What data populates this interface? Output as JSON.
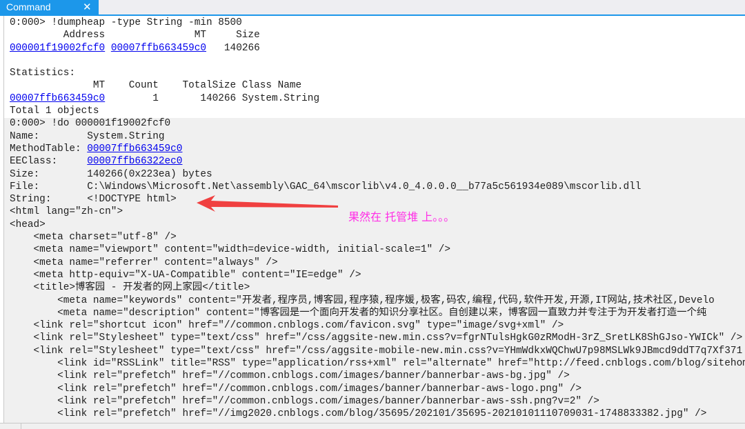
{
  "tab": {
    "title": "Command",
    "close_icon": "close-icon"
  },
  "colors": {
    "tab_bg": "#1c97ea",
    "link": "#0000ee",
    "annotation": "#ff2ee6",
    "arrow": "#f04040",
    "output_bg_gray": "#f0f0f0"
  },
  "output_lines": [
    [
      {
        "t": "0:000> !dumpheap -type String -min 8500"
      }
    ],
    [
      {
        "t": "         Address               MT     Size"
      }
    ],
    [
      {
        "t": "000001f19002fcf0",
        "link": true
      },
      {
        "t": " "
      },
      {
        "t": "00007ffb663459c0",
        "link": true
      },
      {
        "t": "   140266"
      }
    ],
    [
      {
        "t": ""
      }
    ],
    [
      {
        "t": "Statistics:"
      }
    ],
    [
      {
        "t": "              MT    Count    TotalSize Class Name"
      }
    ],
    [
      {
        "t": "00007ffb663459c0",
        "link": true
      },
      {
        "t": "        1       140266 System.String"
      }
    ],
    [
      {
        "t": "Total 1 objects"
      }
    ],
    [
      {
        "t": "0:000> !do 000001f19002fcf0"
      }
    ],
    [
      {
        "t": "Name:        System.String"
      }
    ],
    [
      {
        "t": "MethodTable: "
      },
      {
        "t": "00007ffb663459c0",
        "link": true
      }
    ],
    [
      {
        "t": "EEClass:     "
      },
      {
        "t": "00007ffb66322ec0",
        "link": true
      }
    ],
    [
      {
        "t": "Size:        140266(0x223ea) bytes"
      }
    ],
    [
      {
        "t": "File:        C:\\Windows\\Microsoft.Net\\assembly\\GAC_64\\mscorlib\\v4.0_4.0.0.0__b77a5c561934e089\\mscorlib.dll"
      }
    ],
    [
      {
        "t": "String:      <!DOCTYPE html>"
      }
    ],
    [
      {
        "t": "<html lang=\"zh-cn\">"
      }
    ],
    [
      {
        "t": "<head>"
      }
    ],
    [
      {
        "t": "    <meta charset=\"utf-8\" />"
      }
    ],
    [
      {
        "t": "    <meta name=\"viewport\" content=\"width=device-width, initial-scale=1\" />"
      }
    ],
    [
      {
        "t": "    <meta name=\"referrer\" content=\"always\" />"
      }
    ],
    [
      {
        "t": "    <meta http-equiv=\"X-UA-Compatible\" content=\"IE=edge\" />"
      }
    ],
    [
      {
        "t": "    <title>博客园 - 开发者的网上家园</title>"
      }
    ],
    [
      {
        "t": "        <meta name=\"keywords\" content=\"开发者,程序员,博客园,程序猿,程序媛,极客,码农,编程,代码,软件开发,开源,IT网站,技术社区,Develo"
      }
    ],
    [
      {
        "t": "        <meta name=\"description\" content=\"博客园是一个面向开发者的知识分享社区。自创建以来，博客园一直致力并专注于为开发者打造一个纯"
      }
    ],
    [
      {
        "t": "    <link rel=\"shortcut icon\" href=\"//common.cnblogs.com/favicon.svg\" type=\"image/svg+xml\" />"
      }
    ],
    [
      {
        "t": "    <link rel=\"Stylesheet\" type=\"text/css\" href=\"/css/aggsite-new.min.css?v=fgrNTulsHgkG0zRModH-3rZ_SretLK8ShGJso-YWICk\" />"
      }
    ],
    [
      {
        "t": "    <link rel=\"Stylesheet\" type=\"text/css\" href=\"/css/aggsite-mobile-new.min.css?v=YHmWdkxWQChwU7p98MSLWk9JBmcd9ddT7q7Xf371"
      }
    ],
    [
      {
        "t": "        <link id=\"RSSLink\" title=\"RSS\" type=\"application/rss+xml\" rel=\"alternate\" href=\"http://feed.cnblogs.com/blog/sitehome"
      }
    ],
    [
      {
        "t": "        <link rel=\"prefetch\" href=\"//common.cnblogs.com/images/banner/bannerbar-aws-bg.jpg\" />"
      }
    ],
    [
      {
        "t": "        <link rel=\"prefetch\" href=\"//common.cnblogs.com/images/banner/bannerbar-aws-logo.png\" />"
      }
    ],
    [
      {
        "t": "        <link rel=\"prefetch\" href=\"//common.cnblogs.com/images/banner/bannerbar-aws-ssh.png?v=2\" />"
      }
    ],
    [
      {
        "t": "        <link rel=\"prefetch\" href=\"//img2020.cnblogs.com/blog/35695/202101/35695-20210101110709031-1748833382.jpg\" />"
      }
    ]
  ],
  "annotation": {
    "text": "果然在 托管堆 上。。。",
    "arrow_icon": "arrow-left-icon"
  }
}
